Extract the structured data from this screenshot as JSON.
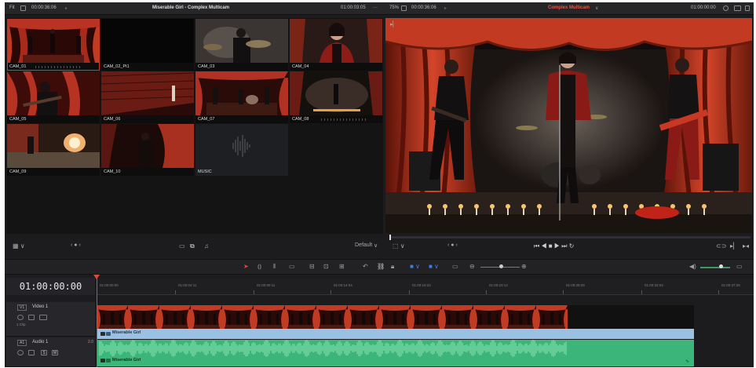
{
  "topbar": {
    "fit_label": "Fit",
    "left_timecode": "00:00:36:06",
    "title": "Miserable Girl - Complex Multicam",
    "right_timecode": "01:00:03:05",
    "dots": "···",
    "zoom": "75%",
    "viewer_timecode": "00:00:36:06",
    "viewer_title": "Complex Multicam",
    "viewer_chevron": "∨",
    "end_timecode": "01:00:00:00"
  },
  "multicam": {
    "angles": [
      {
        "label": "CAM_01",
        "selected": true
      },
      {
        "label": "CAM_02_Pt1",
        "selected": false
      },
      {
        "label": "CAM_03",
        "selected": false
      },
      {
        "label": "CAM_04",
        "selected": false
      },
      {
        "label": "CAM_05",
        "selected": false
      },
      {
        "label": "CAM_06",
        "selected": false
      },
      {
        "label": "CAM_07",
        "selected": false
      },
      {
        "label": "CAM_08",
        "selected": false
      },
      {
        "label": "CAM_09",
        "selected": false
      },
      {
        "label": "CAM_10",
        "selected": false
      },
      {
        "label": "MUSIC",
        "selected": false
      }
    ],
    "selected_color": "#d23a2e"
  },
  "transport": {
    "left_chevrons": "‹ ● ›",
    "default_label": "Default",
    "default_chevron": "∨",
    "right_chevrons": "‹ ● ›",
    "controls": "⏮  ◀  ■  ▶  ⏭  ↻"
  },
  "timeline": {
    "timecode": "01:00:00:00",
    "ruler_ticks": [
      "01:00:00:00",
      "01:00:04:11",
      "01:00:09:11",
      "01:00:14:04",
      "01:00:19:22",
      "01:00:23:13",
      "01:00:28:09",
      "01:00:33:03",
      "01:00:37:28"
    ],
    "video_track": {
      "tag": "V1",
      "name": "Video 1",
      "clip_count": "1 Clip",
      "clip_name": "Miserable Girl"
    },
    "audio_track": {
      "tag": "A1",
      "name": "Audio 1",
      "channels": "2.0",
      "clip_name": "Miserable Girl",
      "s_btn": "S",
      "m_btn": "M"
    },
    "video_clip_color": "#9ac0e4",
    "audio_clip_color": "#3bb57a",
    "playhead_color": "#d64a3c"
  }
}
